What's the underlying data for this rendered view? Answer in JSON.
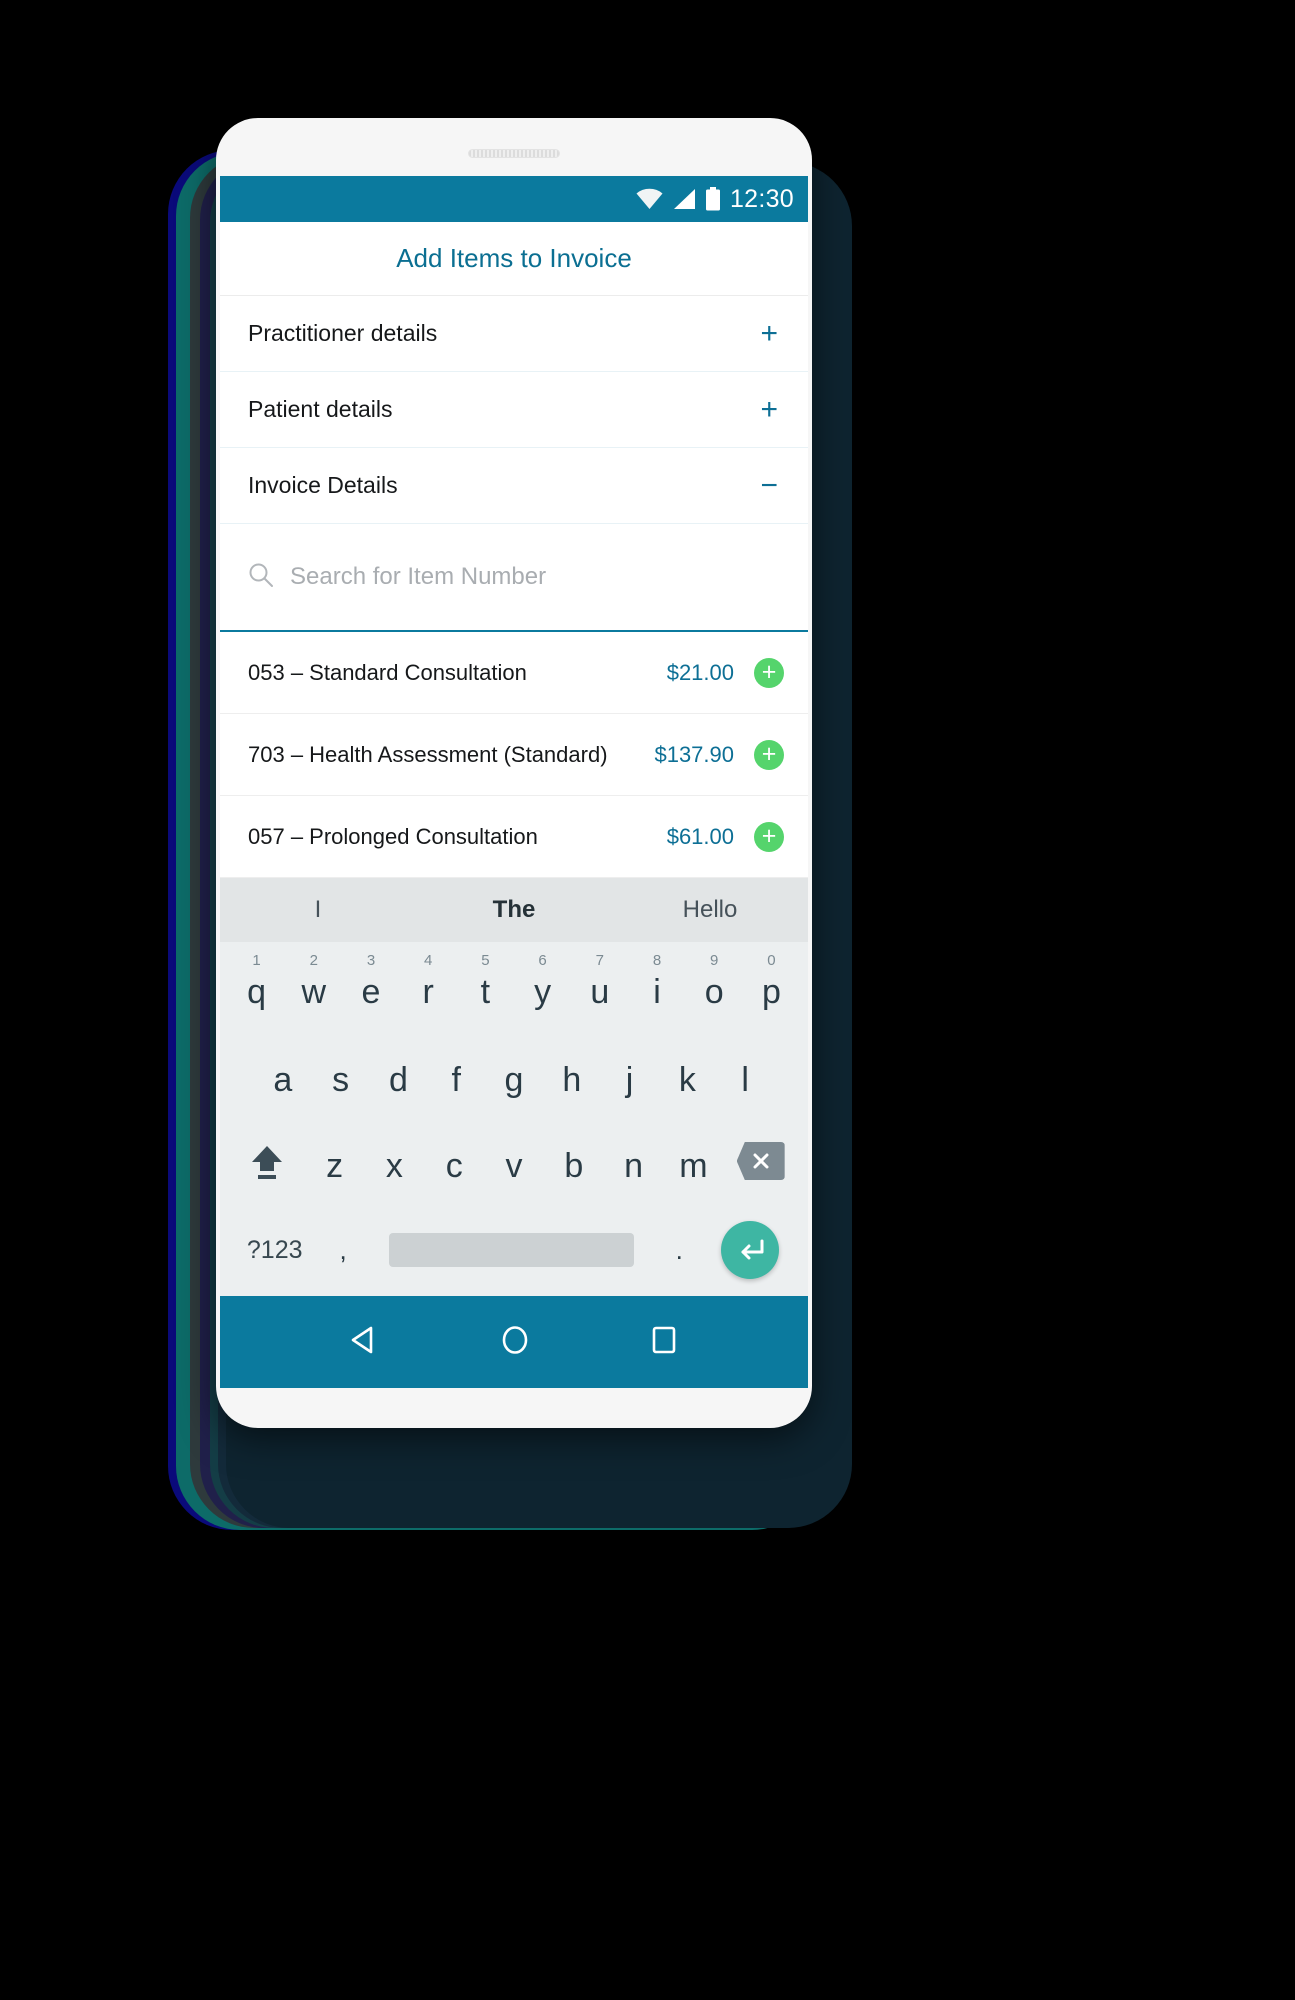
{
  "status_bar": {
    "time": "12:30",
    "icons": [
      "wifi-icon",
      "signal-icon",
      "battery-icon"
    ],
    "bg_color": "#0b7a9e"
  },
  "app": {
    "title": "Add Items to Invoice",
    "title_color": "#0b6f92"
  },
  "accordion": {
    "items": [
      {
        "label": "Practitioner details",
        "sign": "+",
        "expanded": false
      },
      {
        "label": "Patient details",
        "sign": "+",
        "expanded": false
      },
      {
        "label": "Invoice Details",
        "sign": "−",
        "expanded": true
      }
    ]
  },
  "search": {
    "placeholder": "Search for Item Number",
    "value": "",
    "icon": "search-icon"
  },
  "invoice_items": [
    {
      "name": "053 – Standard Consultation",
      "price": "$21.00",
      "add": "+"
    },
    {
      "name": "703 – Health Assessment (Standard)",
      "price": "$137.90",
      "add": "+"
    },
    {
      "name": "057 – Prolonged Consultation",
      "price": "$61.00",
      "add": "+"
    }
  ],
  "colors": {
    "teal": "#0b7a9e",
    "link_teal": "#0d6f95",
    "green_add": "#55d46c",
    "enter_teal": "#3eb6a3"
  },
  "keyboard": {
    "suggestions": [
      {
        "text": "I",
        "bold": false
      },
      {
        "text": "The",
        "bold": true
      },
      {
        "text": "Hello",
        "bold": false
      }
    ],
    "row1": [
      {
        "letter": "q",
        "num": "1"
      },
      {
        "letter": "w",
        "num": "2"
      },
      {
        "letter": "e",
        "num": "3"
      },
      {
        "letter": "r",
        "num": "4"
      },
      {
        "letter": "t",
        "num": "5"
      },
      {
        "letter": "y",
        "num": "6"
      },
      {
        "letter": "u",
        "num": "7"
      },
      {
        "letter": "i",
        "num": "8"
      },
      {
        "letter": "o",
        "num": "9"
      },
      {
        "letter": "p",
        "num": "0"
      }
    ],
    "row2": [
      "a",
      "s",
      "d",
      "f",
      "g",
      "h",
      "j",
      "k",
      "l"
    ],
    "row3": [
      "z",
      "x",
      "c",
      "v",
      "b",
      "n",
      "m"
    ],
    "row3_shift": "shift-icon",
    "row3_backspace": "backspace-icon",
    "row4": {
      "symbols": "?123",
      "comma": ",",
      "space": "",
      "period": ".",
      "enter": "enter-icon"
    }
  },
  "navbar": {
    "back": "back-triangle-icon",
    "home": "home-circle-icon",
    "recents": "recents-square-icon"
  }
}
